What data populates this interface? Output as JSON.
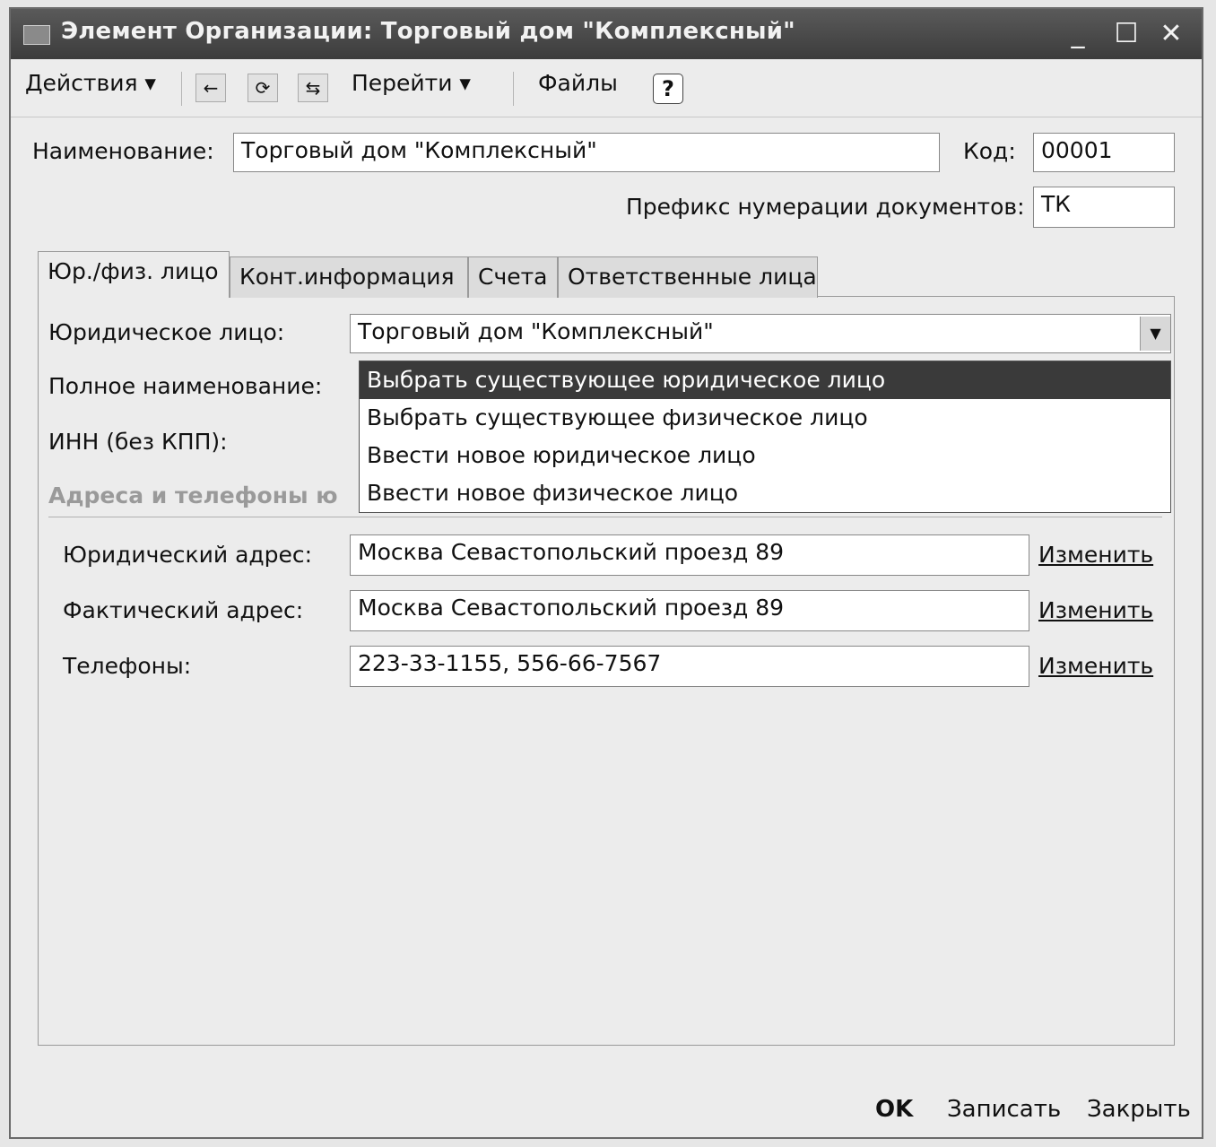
{
  "window": {
    "title": "Элемент Организации: Торговый дом \"Комплексный\""
  },
  "toolbar": {
    "actions_label": "Действия ▾",
    "goto_label": "Перейти ▾",
    "files_label": "Файлы",
    "help_label": "?"
  },
  "header": {
    "name_label": "Наименование:",
    "name_value": "Торговый дом \"Комплексный\"",
    "code_label": "Код:",
    "code_value": "00001",
    "prefix_label": "Префикс нумерации документов:",
    "prefix_value": "ТК"
  },
  "tabs": [
    {
      "label": "Юр./физ. лицо"
    },
    {
      "label": "Конт.информация"
    },
    {
      "label": "Счета"
    },
    {
      "label": "Ответственные лица"
    }
  ],
  "legal": {
    "entity_label": "Юридическое лицо:",
    "entity_value": "Торговый дом \"Комплексный\"",
    "full_name_label": "Полное наименование:",
    "inn_label": "ИНН (без КПП):"
  },
  "dropdown": {
    "items": [
      "Выбрать существующее юридическое лицо",
      "Выбрать существующее физическое лицо",
      "Ввести новое юридическое лицо",
      "Ввести новое физическое лицо"
    ]
  },
  "addresses": {
    "group_title": "Адреса и телефоны ю",
    "legal_address_label": "Юридический адрес:",
    "legal_address_value": "Москва Севастопольский проезд 89",
    "actual_address_label": "Фактический адрес:",
    "actual_address_value": "Москва Севастопольский проезд 89",
    "phones_label": "Телефоны:",
    "phones_value": "223-33-1155, 556-66-7567",
    "change_label": "Изменить"
  },
  "footer": {
    "ok_label": "OK",
    "save_label": "Записать",
    "close_label": "Закрыть"
  }
}
